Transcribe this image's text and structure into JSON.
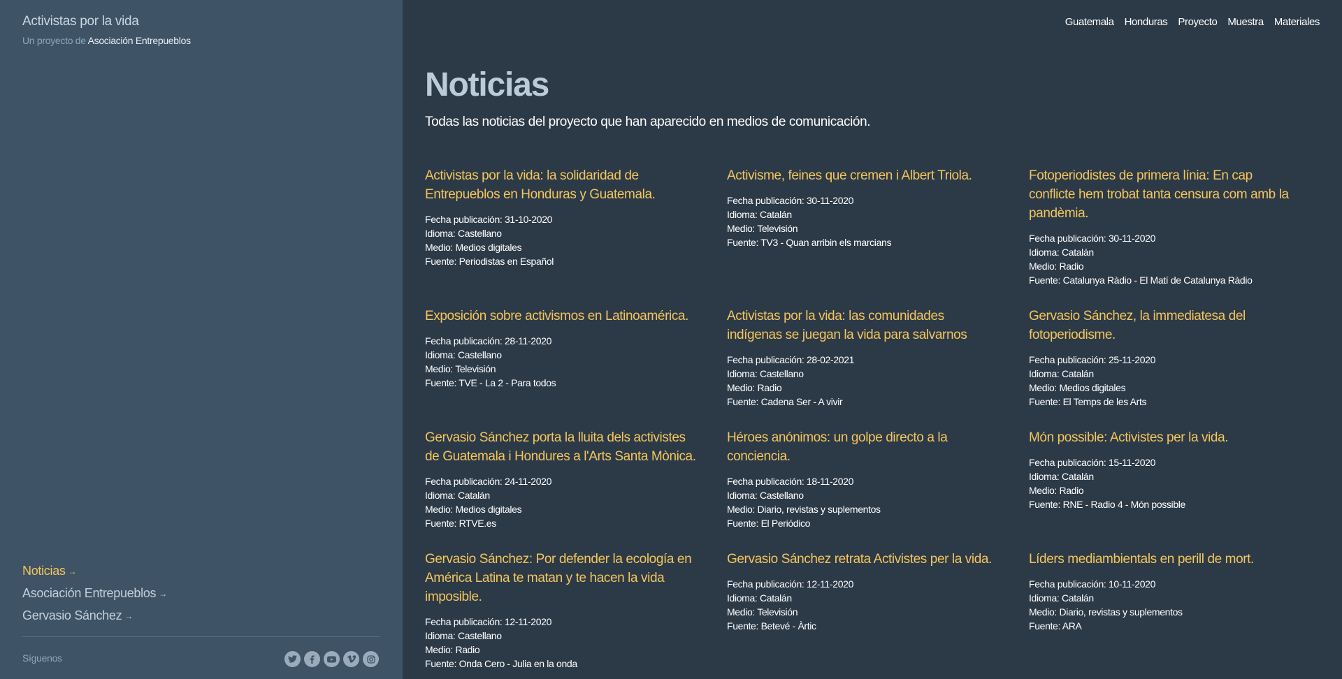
{
  "site": {
    "title": "Activistas por la vida",
    "subtitle_prefix": "Un proyecto de",
    "subtitle_org": "Asociación Entrepueblos"
  },
  "sidebar": {
    "links": [
      {
        "label": "Noticias",
        "arrow": "→",
        "active": true
      },
      {
        "label": "Asociación Entrepueblos",
        "arrow": "→",
        "active": false
      },
      {
        "label": "Gervasio Sánchez",
        "arrow": "→",
        "active": false
      }
    ],
    "follow_label": "Síguenos",
    "social_icons": [
      "twitter-icon",
      "facebook-icon",
      "youtube-icon",
      "vimeo-icon",
      "instagram-icon"
    ]
  },
  "nav": {
    "items": [
      "Guatemala",
      "Honduras",
      "Proyecto",
      "Muestra",
      "Materiales"
    ]
  },
  "page": {
    "title": "Noticias",
    "intro": "Todas las noticias del proyecto que han aparecido en medios de comunicación."
  },
  "news": [
    {
      "title": "Activistas por la vida: la solidaridad de Entrepueblos en Honduras y Guatemala.",
      "date": "Fecha publicación: 31-10-2020",
      "language": "Idioma: Castellano",
      "medium": "Medio: Medios digitales",
      "source": "Fuente: Periodistas en Español"
    },
    {
      "title": "Activisme, feines que cremen i Albert Triola.",
      "date": "Fecha publicación: 30-11-2020",
      "language": "Idioma: Catalán",
      "medium": "Medio: Televisión",
      "source": "Fuente: TV3 - Quan arribin els marcians"
    },
    {
      "title": "Fotoperiodistes de primera línia: En cap conflicte hem trobat tanta censura com amb la pandèmia.",
      "date": "Fecha publicación: 30-11-2020",
      "language": "Idioma: Catalán",
      "medium": "Medio: Radio",
      "source": "Fuente: Catalunya Ràdio - El Matí de Catalunya Ràdio"
    },
    {
      "title": "Exposición sobre activismos en Latinoamérica.",
      "date": "Fecha publicación: 28-11-2020",
      "language": "Idioma: Castellano",
      "medium": "Medio: Televisión",
      "source": "Fuente: TVE - La 2 - Para todos"
    },
    {
      "title": "Activistas por la vida: las comunidades indígenas se juegan la vida para salvarnos",
      "date": "Fecha publicación: 28-02-2021",
      "language": "Idioma: Castellano",
      "medium": "Medio: Radio",
      "source": "Fuente: Cadena Ser - A vivir"
    },
    {
      "title": "Gervasio Sánchez, la immediatesa del fotoperiodisme.",
      "date": "Fecha publicación: 25-11-2020",
      "language": "Idioma: Catalán",
      "medium": "Medio: Medios digitales",
      "source": "Fuente: El Temps de les Arts"
    },
    {
      "title": "Gervasio Sánchez porta la lluita dels activistes de Guatemala i Hondures a l'Arts Santa Mònica.",
      "date": "Fecha publicación: 24-11-2020",
      "language": "Idioma: Catalán",
      "medium": "Medio: Medios digitales",
      "source": "Fuente: RTVE.es"
    },
    {
      "title": "Héroes anónimos: un golpe directo a la conciencia.",
      "date": "Fecha publicación: 18-11-2020",
      "language": "Idioma: Castellano",
      "medium": "Medio: Diario, revistas y suplementos",
      "source": "Fuente: El Periódico"
    },
    {
      "title": "Món possible: Activistes per la vida.",
      "date": "Fecha publicación: 15-11-2020",
      "language": "Idioma: Catalán",
      "medium": "Medio: Radio",
      "source": "Fuente: RNE - Radio 4 - Món possible"
    },
    {
      "title": "Gervasio Sánchez: Por defender la ecología en América Latina te matan y te hacen la vida imposible.",
      "date": "Fecha publicación: 12-11-2020",
      "language": "Idioma: Castellano",
      "medium": "Medio: Radio",
      "source": "Fuente: Onda Cero - Julia en la onda"
    },
    {
      "title": "Gervasio Sánchez retrata Activistes per la vida.",
      "date": "Fecha publicación: 12-11-2020",
      "language": "Idioma: Catalán",
      "medium": "Medio: Televisión",
      "source": "Fuente: Betevé - Àrtic"
    },
    {
      "title": "Líders mediambientals en perill de mort.",
      "date": "Fecha publicación: 10-11-2020",
      "language": "Idioma: Catalán",
      "medium": "Medio: Diario, revistas y suplementos",
      "source": "Fuente: ARA"
    }
  ],
  "colors": {
    "accent": "#f4c55b",
    "sidebar_bg": "#3e5366",
    "main_bg": "#2c3a48"
  }
}
